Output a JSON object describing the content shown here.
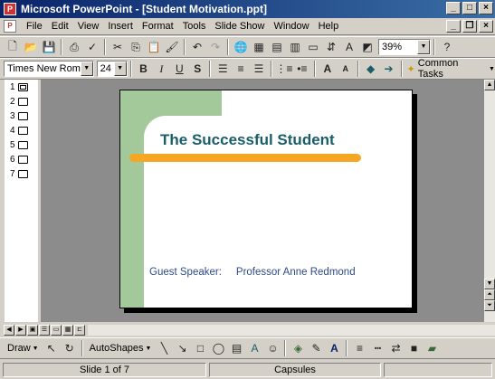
{
  "window": {
    "title": "Microsoft PowerPoint - [Student Motivation.ppt]"
  },
  "menu": [
    "File",
    "Edit",
    "View",
    "Insert",
    "Format",
    "Tools",
    "Slide Show",
    "Window",
    "Help"
  ],
  "standard_toolbar": {
    "zoom": "39%"
  },
  "formatting_toolbar": {
    "font": "Times New Roman",
    "size": "24",
    "common_tasks": "Common Tasks"
  },
  "outline": {
    "slides": [
      "1",
      "2",
      "3",
      "4",
      "5",
      "6",
      "7"
    ]
  },
  "slide": {
    "title": "The Successful Student",
    "speaker_label": "Guest Speaker:",
    "speaker_name": "Professor Anne Redmond"
  },
  "drawing_toolbar": {
    "draw": "Draw",
    "autoshapes": "AutoShapes"
  },
  "status": {
    "slide": "Slide 1 of 7",
    "design": "Capsules"
  },
  "colors": {
    "title_bar": "#0a246a",
    "slide_title": "#1a5e6a",
    "accent_bar": "#f5a623",
    "side_band": "#a3c99a",
    "speaker_text": "#2e4a8a"
  }
}
